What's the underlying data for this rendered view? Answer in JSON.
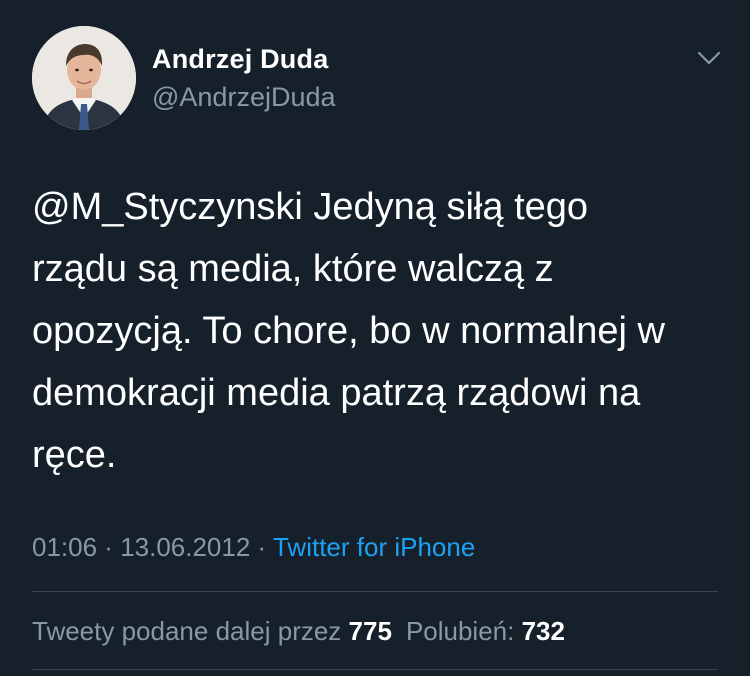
{
  "author": {
    "name": "Andrzej Duda",
    "handle": "@AndrzejDuda"
  },
  "icons": {
    "options": "chevron-down-icon",
    "avatar": "profile-photo"
  },
  "tweet": {
    "text": "@M_Styczynski Jedyną siłą tego\nrządu są media, które walczą z\nopozycją. To chore, bo w normalnej w\ndemokracji media patrzą rządowi na\nręce.",
    "time": "01:06",
    "sep1": " · ",
    "date": "13.06.2012",
    "sep2": " · ",
    "source": "Twitter for iPhone"
  },
  "stats": {
    "retweets_label": "Tweety podane dalej przez",
    "retweets_count": "775",
    "likes_label": "Polubień:",
    "likes_count": "732"
  },
  "colors": {
    "background": "#15202b",
    "secondary_text": "#8899a6",
    "link": "#1da1f2",
    "divider": "#38444d"
  }
}
